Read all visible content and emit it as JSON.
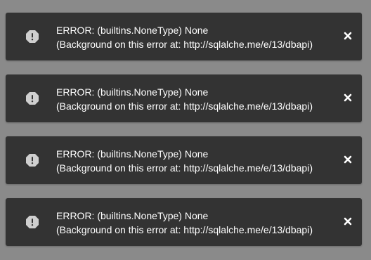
{
  "toasts": [
    {
      "icon": "alert-octagon-icon",
      "line1": "ERROR: (builtins.NoneType) None",
      "line2": "(Background on this error at: http://sqlalche.me/e/13/dbapi)",
      "close_icon": "close-icon"
    },
    {
      "icon": "alert-octagon-icon",
      "line1": "ERROR: (builtins.NoneType) None",
      "line2": "(Background on this error at: http://sqlalche.me/e/13/dbapi)",
      "close_icon": "close-icon"
    },
    {
      "icon": "alert-octagon-icon",
      "line1": "ERROR: (builtins.NoneType) None",
      "line2": "(Background on this error at: http://sqlalche.me/e/13/dbapi)",
      "close_icon": "close-icon"
    },
    {
      "icon": "alert-octagon-icon",
      "line1": "ERROR: (builtins.NoneType) None",
      "line2": "(Background on this error at: http://sqlalche.me/e/13/dbapi)",
      "close_icon": "close-icon"
    }
  ],
  "colors": {
    "page_background": "#8a8a8a",
    "toast_background": "#333333",
    "text": "#ffffff",
    "icon": "#cfcfcf"
  }
}
